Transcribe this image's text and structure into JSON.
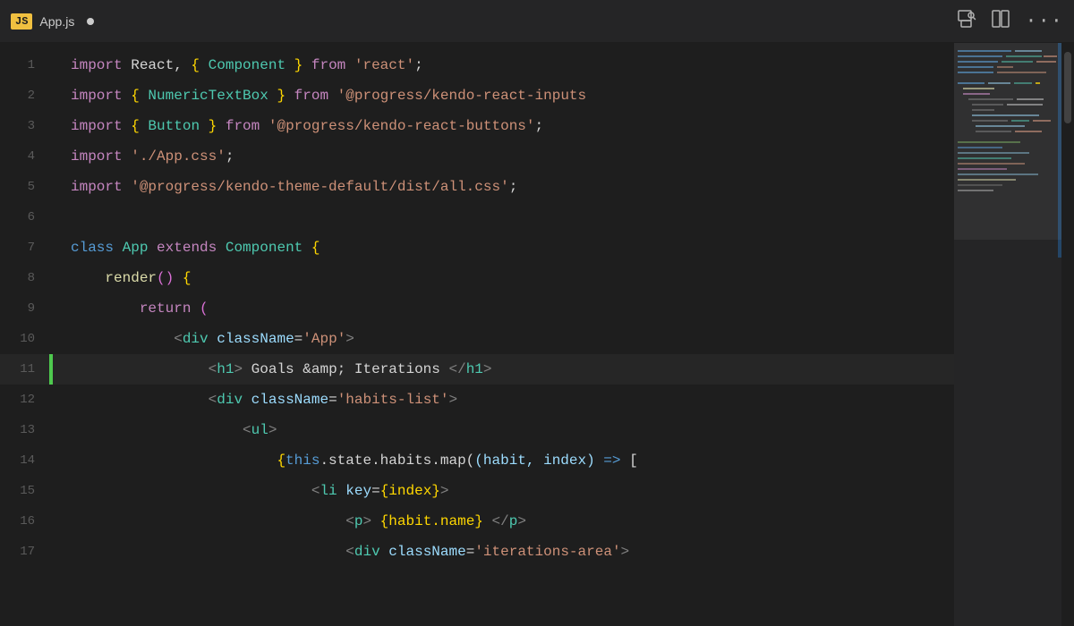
{
  "titlebar": {
    "js_badge": "JS",
    "filename": "App.js",
    "unsaved_dot": "●"
  },
  "toolbar_icons": {
    "search": "🔍",
    "layout": "▣",
    "more": "⋯"
  },
  "lines": [
    {
      "number": "1",
      "indicator": "",
      "tokens": [
        {
          "text": "import",
          "cls": "kw-import"
        },
        {
          "text": " React, ",
          "cls": "plain"
        },
        {
          "text": "{",
          "cls": "brace"
        },
        {
          "text": " Component ",
          "cls": "component"
        },
        {
          "text": "}",
          "cls": "brace"
        },
        {
          "text": " from ",
          "cls": "kw-from"
        },
        {
          "text": "'react'",
          "cls": "str"
        },
        {
          "text": ";",
          "cls": "plain"
        }
      ]
    },
    {
      "number": "2",
      "indicator": "",
      "tokens": [
        {
          "text": "import",
          "cls": "kw-import"
        },
        {
          "text": " ",
          "cls": "plain"
        },
        {
          "text": "{",
          "cls": "brace"
        },
        {
          "text": " NumericTextBox ",
          "cls": "numericbox"
        },
        {
          "text": "}",
          "cls": "brace"
        },
        {
          "text": " from ",
          "cls": "kw-from"
        },
        {
          "text": "'@progress/kendo-react-inputs",
          "cls": "str"
        }
      ]
    },
    {
      "number": "3",
      "indicator": "",
      "tokens": [
        {
          "text": "import",
          "cls": "kw-import"
        },
        {
          "text": " ",
          "cls": "plain"
        },
        {
          "text": "{",
          "cls": "brace"
        },
        {
          "text": " Button ",
          "cls": "component"
        },
        {
          "text": "}",
          "cls": "brace"
        },
        {
          "text": " from ",
          "cls": "kw-from"
        },
        {
          "text": "'@progress/kendo-react-buttons'",
          "cls": "str"
        },
        {
          "text": ";",
          "cls": "plain"
        }
      ]
    },
    {
      "number": "4",
      "indicator": "",
      "tokens": [
        {
          "text": "import",
          "cls": "kw-import"
        },
        {
          "text": " ",
          "cls": "plain"
        },
        {
          "text": "'./App.css'",
          "cls": "str"
        },
        {
          "text": ";",
          "cls": "plain"
        }
      ]
    },
    {
      "number": "5",
      "indicator": "",
      "tokens": [
        {
          "text": "import",
          "cls": "kw-import"
        },
        {
          "text": " ",
          "cls": "plain"
        },
        {
          "text": "'@progress/kendo-theme-default/dist/all.css'",
          "cls": "str"
        },
        {
          "text": ";",
          "cls": "plain"
        }
      ]
    },
    {
      "number": "6",
      "indicator": "",
      "tokens": []
    },
    {
      "number": "7",
      "indicator": "",
      "tokens": [
        {
          "text": "class",
          "cls": "kw-class"
        },
        {
          "text": " App ",
          "cls": "component"
        },
        {
          "text": "extends",
          "cls": "kw-extends"
        },
        {
          "text": " Component ",
          "cls": "component"
        },
        {
          "text": "{",
          "cls": "brace"
        }
      ]
    },
    {
      "number": "8",
      "indicator": "",
      "tokens": [
        {
          "text": "    render",
          "cls": "method"
        },
        {
          "text": "(",
          "cls": "paren"
        },
        {
          "text": ")",
          "cls": "paren"
        },
        {
          "text": " {",
          "cls": "brace"
        }
      ]
    },
    {
      "number": "9",
      "indicator": "",
      "tokens": [
        {
          "text": "        return",
          "cls": "keyword"
        },
        {
          "text": " (",
          "cls": "paren"
        }
      ]
    },
    {
      "number": "10",
      "indicator": "",
      "tokens": [
        {
          "text": "            ",
          "cls": "plain"
        },
        {
          "text": "<",
          "cls": "jsx-tag"
        },
        {
          "text": "div",
          "cls": "component"
        },
        {
          "text": " ",
          "cls": "plain"
        },
        {
          "text": "className",
          "cls": "jsx-attr"
        },
        {
          "text": "=",
          "cls": "plain"
        },
        {
          "text": "'App'",
          "cls": "jsx-attr-val"
        },
        {
          "text": ">",
          "cls": "jsx-tag"
        }
      ]
    },
    {
      "number": "11",
      "indicator": "green",
      "tokens": [
        {
          "text": "                ",
          "cls": "plain"
        },
        {
          "text": "<",
          "cls": "jsx-tag"
        },
        {
          "text": "h1",
          "cls": "component"
        },
        {
          "text": ">",
          "cls": "jsx-tag"
        },
        {
          "text": " Goals &amp; Iterations ",
          "cls": "jsx-text"
        },
        {
          "text": "</",
          "cls": "jsx-tag"
        },
        {
          "text": "h1",
          "cls": "component"
        },
        {
          "text": ">",
          "cls": "jsx-tag"
        }
      ]
    },
    {
      "number": "12",
      "indicator": "",
      "tokens": [
        {
          "text": "                ",
          "cls": "plain"
        },
        {
          "text": "<",
          "cls": "jsx-tag"
        },
        {
          "text": "div",
          "cls": "component"
        },
        {
          "text": " ",
          "cls": "plain"
        },
        {
          "text": "className",
          "cls": "jsx-attr"
        },
        {
          "text": "=",
          "cls": "plain"
        },
        {
          "text": "'habits-list'",
          "cls": "jsx-attr-val"
        },
        {
          "text": ">",
          "cls": "jsx-tag"
        }
      ]
    },
    {
      "number": "13",
      "indicator": "",
      "tokens": [
        {
          "text": "                    ",
          "cls": "plain"
        },
        {
          "text": "<",
          "cls": "jsx-tag"
        },
        {
          "text": "ul",
          "cls": "component"
        },
        {
          "text": ">",
          "cls": "jsx-tag"
        }
      ]
    },
    {
      "number": "14",
      "indicator": "",
      "tokens": [
        {
          "text": "                        ",
          "cls": "plain"
        },
        {
          "text": "{",
          "cls": "brace"
        },
        {
          "text": "this",
          "cls": "this-kw"
        },
        {
          "text": ".state.habits.map(",
          "cls": "plain"
        },
        {
          "text": "(habit, index)",
          "cls": "ident"
        },
        {
          "text": " => ",
          "cls": "arrow"
        },
        {
          "text": "[",
          "cls": "plain"
        }
      ]
    },
    {
      "number": "15",
      "indicator": "",
      "tokens": [
        {
          "text": "                            ",
          "cls": "plain"
        },
        {
          "text": "<",
          "cls": "jsx-tag"
        },
        {
          "text": "li",
          "cls": "component"
        },
        {
          "text": " ",
          "cls": "plain"
        },
        {
          "text": "key",
          "cls": "jsx-attr"
        },
        {
          "text": "=",
          "cls": "plain"
        },
        {
          "text": "{index}",
          "cls": "brace"
        },
        {
          "text": ">",
          "cls": "jsx-tag"
        }
      ]
    },
    {
      "number": "16",
      "indicator": "",
      "tokens": [
        {
          "text": "                                ",
          "cls": "plain"
        },
        {
          "text": "<",
          "cls": "jsx-tag"
        },
        {
          "text": "p",
          "cls": "component"
        },
        {
          "text": ">",
          "cls": "jsx-tag"
        },
        {
          "text": " {habit.name} ",
          "cls": "brace"
        },
        {
          "text": "</",
          "cls": "jsx-tag"
        },
        {
          "text": "p",
          "cls": "component"
        },
        {
          "text": ">",
          "cls": "jsx-tag"
        }
      ]
    },
    {
      "number": "17",
      "indicator": "",
      "tokens": [
        {
          "text": "                                ",
          "cls": "plain"
        },
        {
          "text": "<",
          "cls": "jsx-tag"
        },
        {
          "text": "div",
          "cls": "component"
        },
        {
          "text": " ",
          "cls": "plain"
        },
        {
          "text": "className",
          "cls": "jsx-attr"
        },
        {
          "text": "=",
          "cls": "plain"
        },
        {
          "text": "'iterations-area'",
          "cls": "jsx-attr-val"
        },
        {
          "text": ">",
          "cls": "jsx-tag"
        }
      ]
    }
  ]
}
